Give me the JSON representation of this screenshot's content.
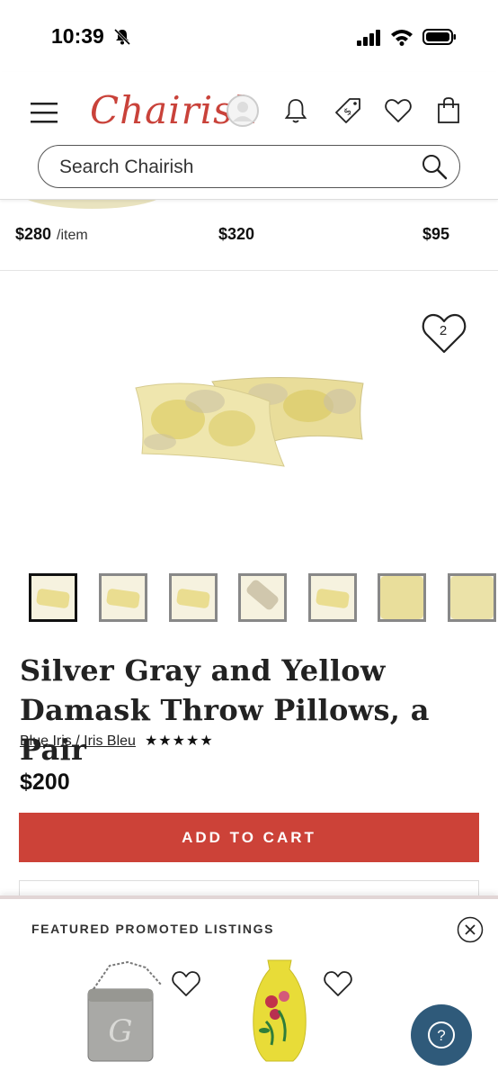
{
  "status_bar": {
    "time": "10:39"
  },
  "header": {
    "logo": "Chairish",
    "search": {
      "placeholder": "Search Chairish"
    }
  },
  "previous_row": {
    "prices": [
      {
        "amount": "$280",
        "unit": "/item"
      },
      {
        "amount": "$320",
        "unit": ""
      },
      {
        "amount": "$95",
        "unit": ""
      }
    ]
  },
  "product": {
    "favorite_count": "2",
    "thumbnail_count": 7,
    "active_thumbnail": 1,
    "title": "Silver Gray and Yellow Damask Throw Pillows, a Pair",
    "seller": "Blue Iris / Iris Bleu",
    "rating_stars": "★★★★★",
    "price": "$200",
    "add_to_cart_label": "ADD TO CART"
  },
  "featured": {
    "title": "FEATURED PROMOTED LISTINGS",
    "items": [
      "silver-monogram-purse",
      "yellow-floral-vase"
    ]
  },
  "colors": {
    "brand_red": "#cc4238",
    "help_button": "#2f5a7a"
  }
}
